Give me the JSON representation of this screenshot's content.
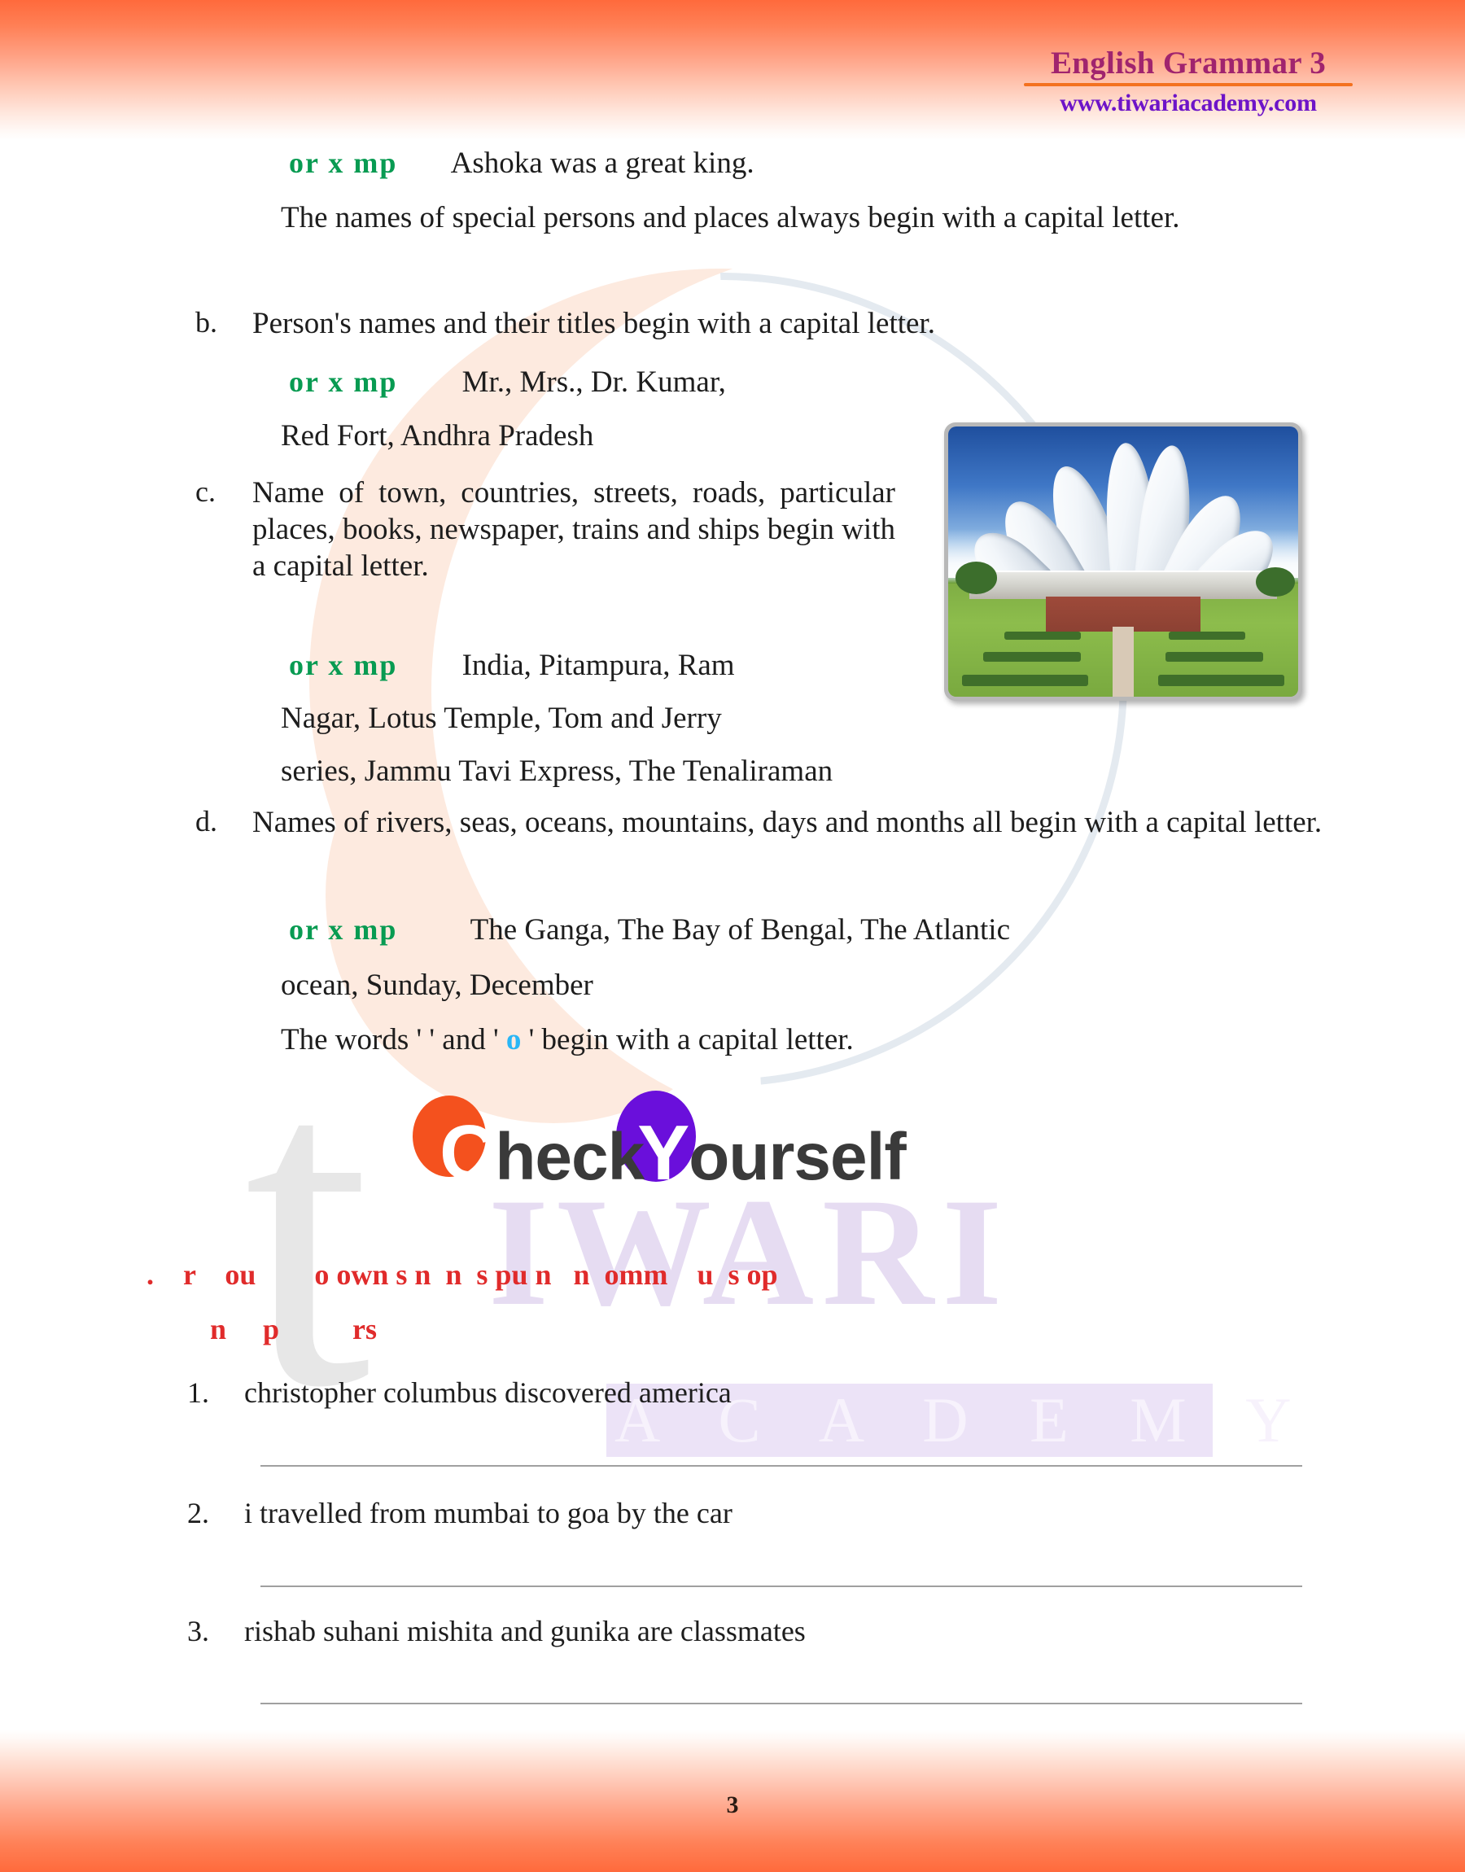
{
  "header": {
    "title": "English Grammar 3",
    "url": "www.tiwariacademy.com",
    "title_color": "#a0246e",
    "url_color": "#6d14c8",
    "rule_color": "#f4711f"
  },
  "rules": [
    {
      "marker": "",
      "example_label": "or  x  mp",
      "example_text": "Ashoka was a great king.",
      "note": "The names of special persons and places always begin with a capital letter."
    },
    {
      "marker": "b.",
      "text": "Person's names and their titles begin with a capital letter.",
      "example_label": "or  x  mp",
      "example_text": "Mr.,  Mrs.,  Dr. Kumar,",
      "example_text2": "Red Fort,  Andhra Pradesh"
    },
    {
      "marker": "c.",
      "text": "Name of town, countries, streets, roads, particular places, books, newspaper, trains and ships begin with a capital letter.",
      "example_label": "or  x  mp",
      "example_text": "India, Pitampura,  Ram",
      "example_text2": "Nagar,   Lotus Temple,   Tom and Jerry",
      "example_text3": "series,  Jammu Tavi Express,  The Tenaliraman"
    },
    {
      "marker": "d.",
      "text": "Names of rivers, seas, oceans, mountains, days and months all begin with a capital letter.",
      "example_label": "or   x  mp",
      "example_text": "The Ganga, The Bay of Bengal, The Atlantic",
      "example_text2": "ocean, Sunday, December"
    }
  ],
  "closing_line": {
    "before": "The words ' ' and ' ",
    "highlight": "o",
    "after": " ' begin with a capital letter.",
    "highlight_color": "#29b6f6"
  },
  "check_yourself": {
    "big_c": "C",
    "rest1": "heck ",
    "big_y": "Y",
    "rest2": "ourself",
    "circle_c_color": "#f4511e",
    "circle_y_color": "#6a0fdb",
    "text_color": "#3a3a3a"
  },
  "instruction": {
    "line1": ".    r    ou        o own s n  n  s pu n   n  omm    u  s op",
    "line2": "n     p          rs",
    "color": "#e02b2b"
  },
  "questions": [
    {
      "num": "1.",
      "text": "christopher columbus discovered america"
    },
    {
      "num": "2.",
      "text": "i travelled from mumbai to goa by the car"
    },
    {
      "num": "3.",
      "text": "rishab suhani mishita and gunika are classmates"
    }
  ],
  "image_caption": "lotus-temple-photo",
  "watermarks": {
    "t_letter": "t",
    "tiwari": "IWARI",
    "academy": "A C A D E M Y"
  },
  "footer": {
    "page_number": "3"
  },
  "colors": {
    "green_example": "#089b52",
    "band_orange": "#ff6a3c",
    "body_text": "#1d1d1d"
  }
}
